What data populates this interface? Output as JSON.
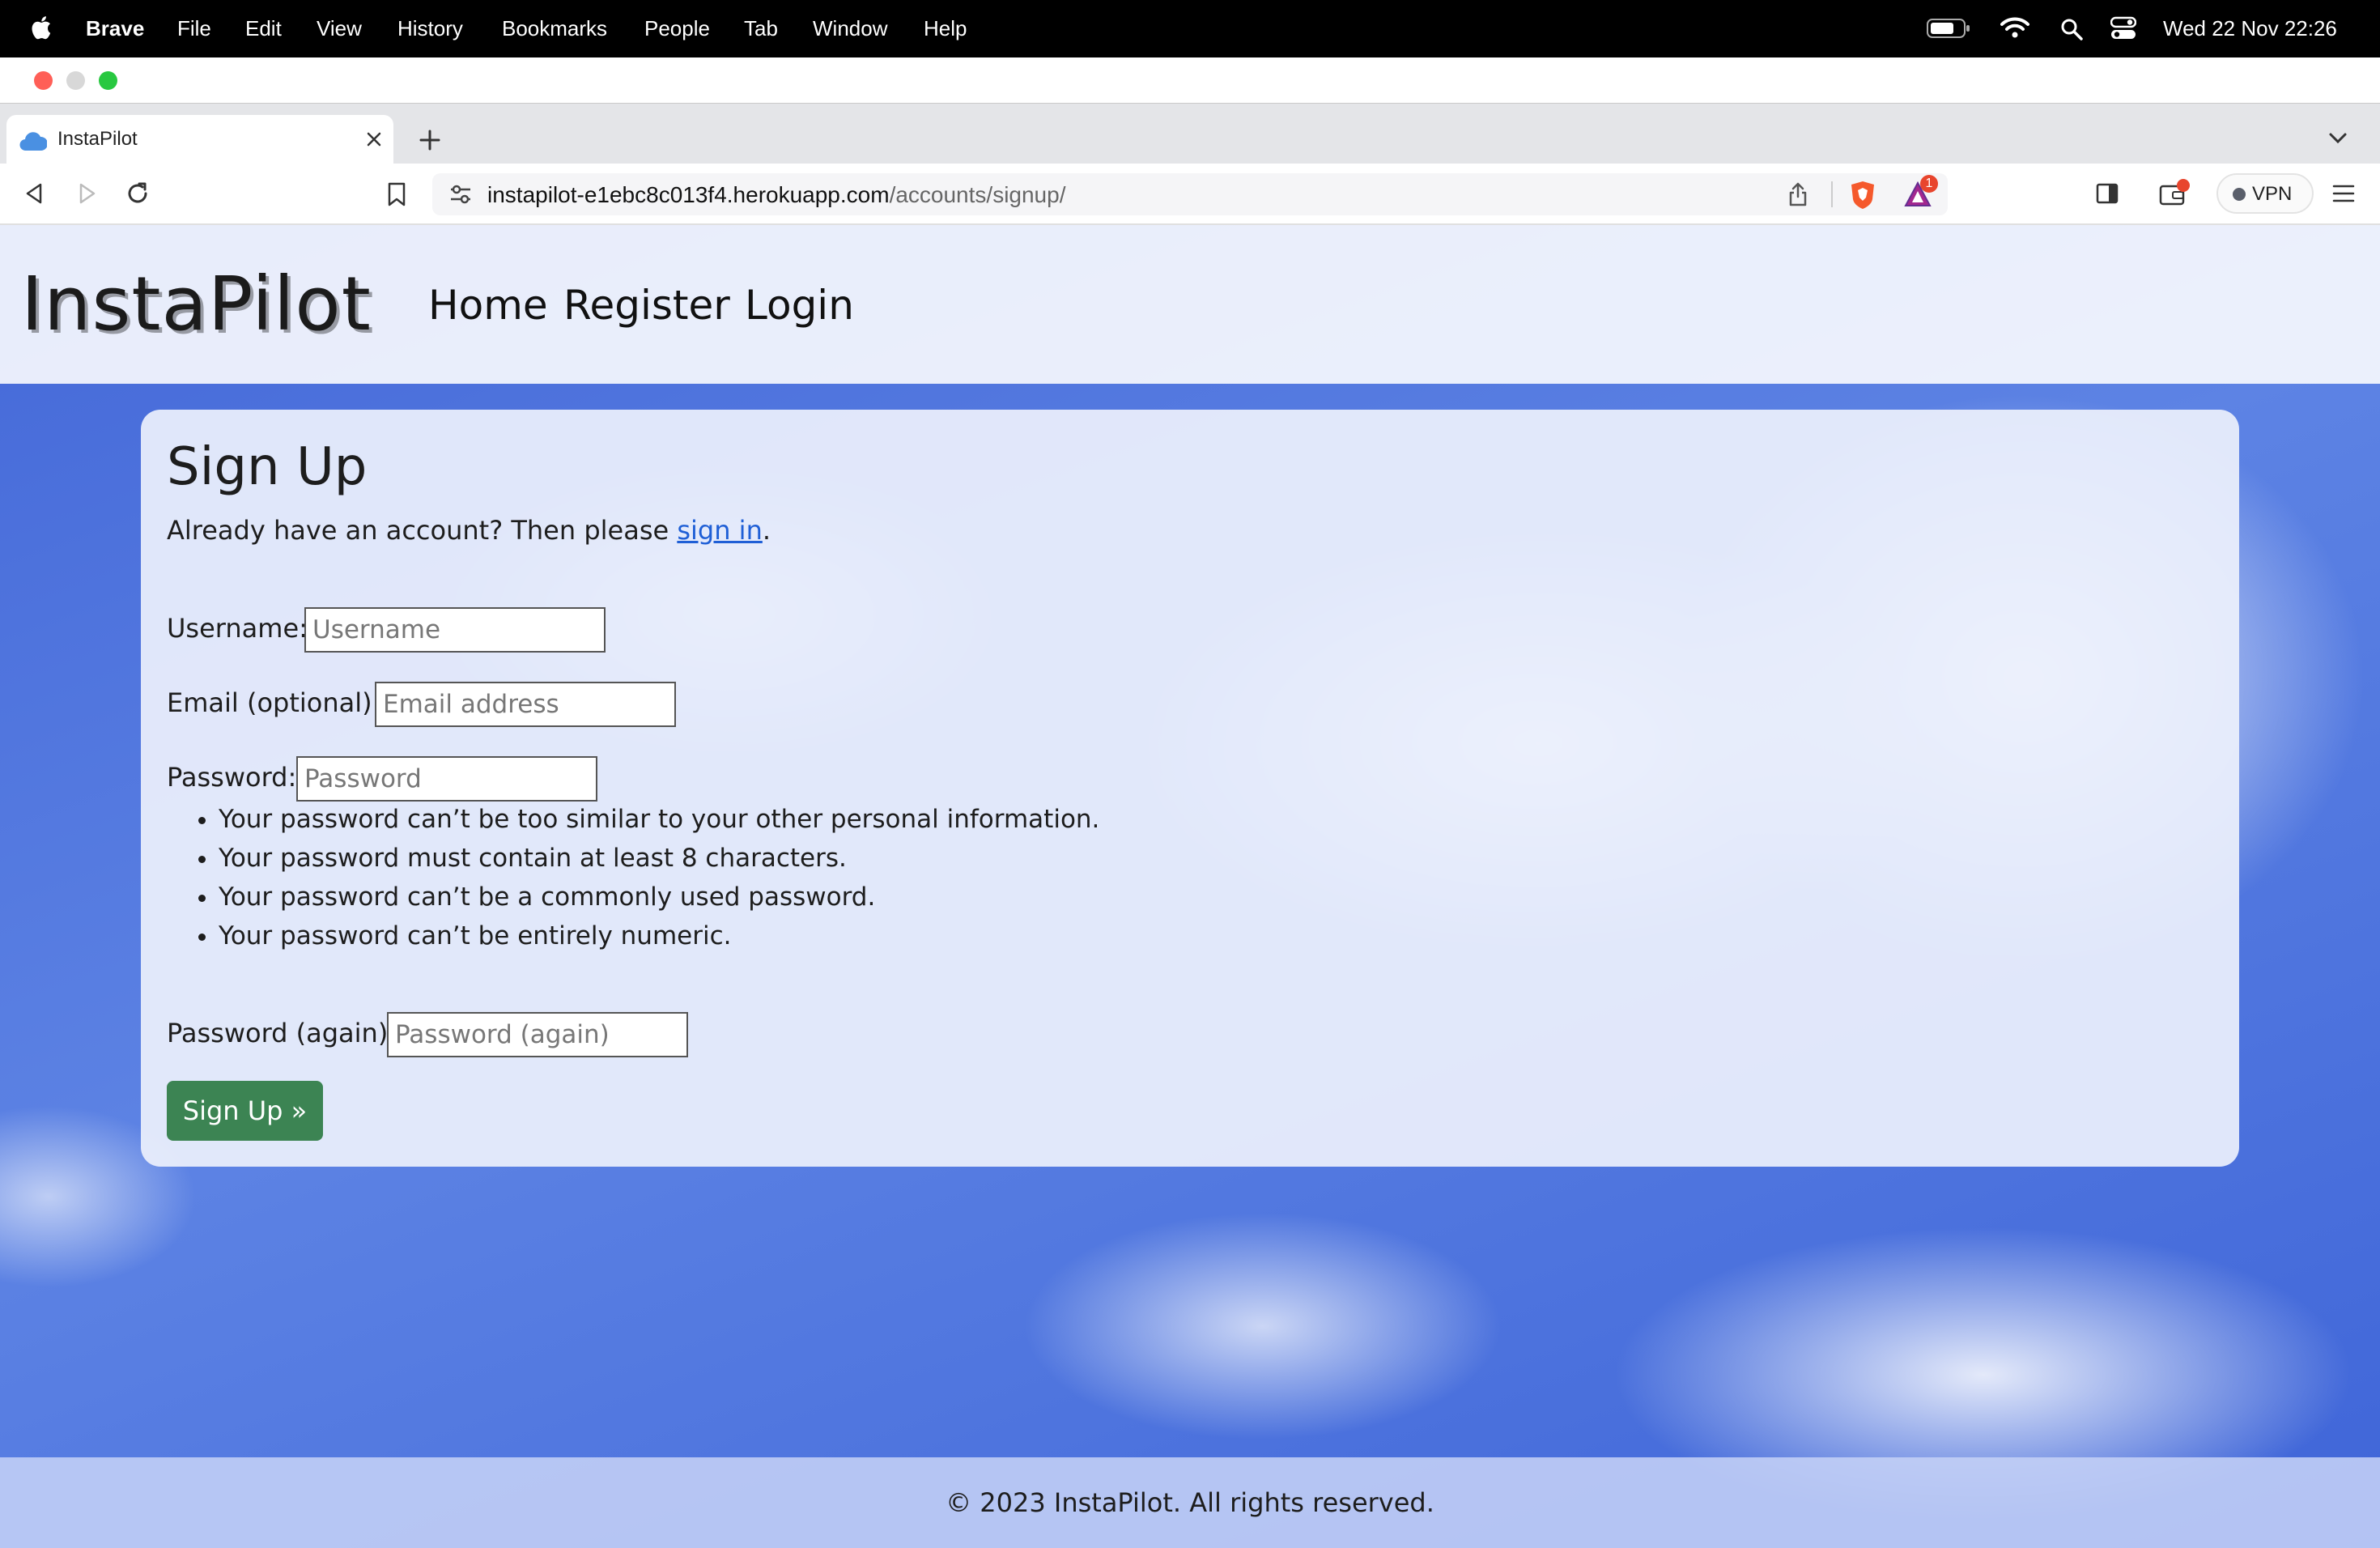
{
  "menubar": {
    "app_name": "Brave",
    "items": [
      "File",
      "Edit",
      "View",
      "History",
      "Bookmarks",
      "People",
      "Tab",
      "Window",
      "Help"
    ],
    "clock": "Wed 22 Nov  22:26"
  },
  "browser": {
    "tab_title": "InstaPilot",
    "url_host": "instapilot-e1ebc8c013f4.herokuapp.com",
    "url_path": "/accounts/signup/",
    "vpn_label": "VPN",
    "rewards_badge": "1"
  },
  "site": {
    "logo": "InstaPilot",
    "nav": {
      "home": "Home",
      "register": "Register",
      "login": "Login"
    }
  },
  "signup": {
    "title": "Sign Up",
    "intro_prefix": "Already have an account? Then please ",
    "intro_link": "sign in",
    "intro_suffix": ".",
    "username_label": "Username:",
    "username_placeholder": "Username",
    "email_label": "Email (optional):",
    "email_placeholder": "Email address",
    "password_label": "Password:",
    "password_placeholder": "Password",
    "password_rules": [
      "Your password can’t be too similar to your other personal information.",
      "Your password must contain at least 8 characters.",
      "Your password can’t be a commonly used password.",
      "Your password can’t be entirely numeric."
    ],
    "password2_label": "Password (again):",
    "password2_placeholder": "Password (again)",
    "submit_label": "Sign Up »"
  },
  "footer": {
    "text": "© 2023 InstaPilot. All rights reserved."
  },
  "colors": {
    "button": "#3c8453",
    "link": "#1f5fd6",
    "close_light": "#ff5f57",
    "zoom_light": "#28c840"
  }
}
